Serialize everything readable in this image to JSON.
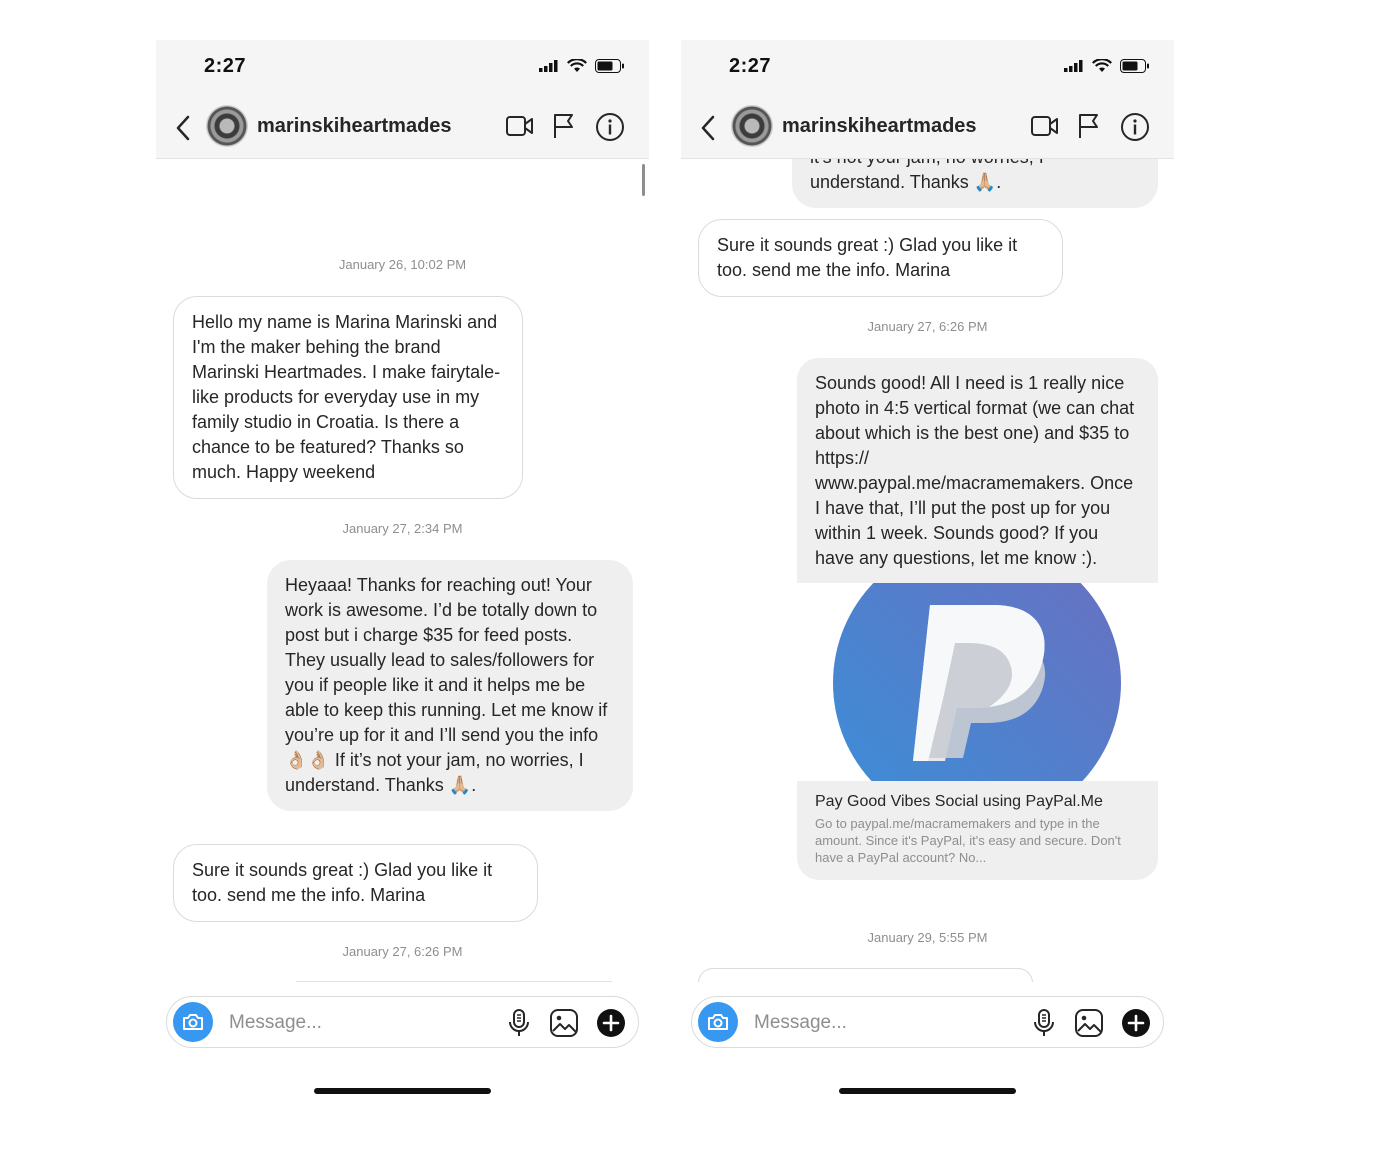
{
  "status": {
    "time": "2:27"
  },
  "contact": {
    "name": "marinskiheartmades"
  },
  "composer": {
    "placeholder": "Message..."
  },
  "timestamps": {
    "jan26_1002": "January 26, 10:02 PM",
    "jan27_234": "January 27, 2:34 PM",
    "jan27_626": "January 27, 6:26 PM",
    "jan29_555": "January 29, 5:55 PM"
  },
  "messages": {
    "marina_intro": "Hello my name is Marina Marinski and I'm the maker behing the brand Marinski Heartmades. I make fairytale-like products for everyday use in my family studio in Croatia. Is there a chance to be featured? Thanks so much. Happy weekend",
    "reply_pricing": "Heyaaa! Thanks for reaching out! Your work is awesome. I’d be totally down to post but i charge $35 for feed posts. They usually lead to sales/followers for you if people like it and it helps me be able to keep this running. Let me know if you’re up for it and I’ll send you the info 👌🏼👌🏼 If it’s not your jam, no worries, I understand. Thanks 🙏🏼.",
    "marina_agree": "Sure it sounds great :) Glad you like it too. send me the info. Marina",
    "reply_pricing_tail": "it’s not your jam, no worries, I understand. Thanks 🙏🏼.",
    "reply_payment": "Sounds good! All I need is 1 really nice photo in 4:5 vertical format (we can chat about which is the best one) and $35 to https:// www.paypal.me/macramemakers. Once I have that, I’ll put the post up for you within 1 week. Sounds good? If you have any questions, let me know :)."
  },
  "link_preview": {
    "title": "Pay Good Vibes Social using PayPal.Me",
    "description": "Go to paypal.me/macramemakers and type in the amount. Since it's PayPal, it's easy and secure. Don't have a PayPal account? No..."
  },
  "icons": {
    "back": "chevron-left-icon",
    "video": "video-camera-icon",
    "flag": "flag-icon",
    "info": "info-icon",
    "camera": "camera-icon",
    "mic": "microphone-icon",
    "gallery": "image-icon",
    "plus": "plus-icon"
  },
  "colors": {
    "camera_button": "#3897f0",
    "outgoing_bubble": "#efefef",
    "incoming_border": "#dbdbdb",
    "paypal_blue_light": "#3a8fd8",
    "paypal_blue_dark": "#6b6fc0"
  }
}
